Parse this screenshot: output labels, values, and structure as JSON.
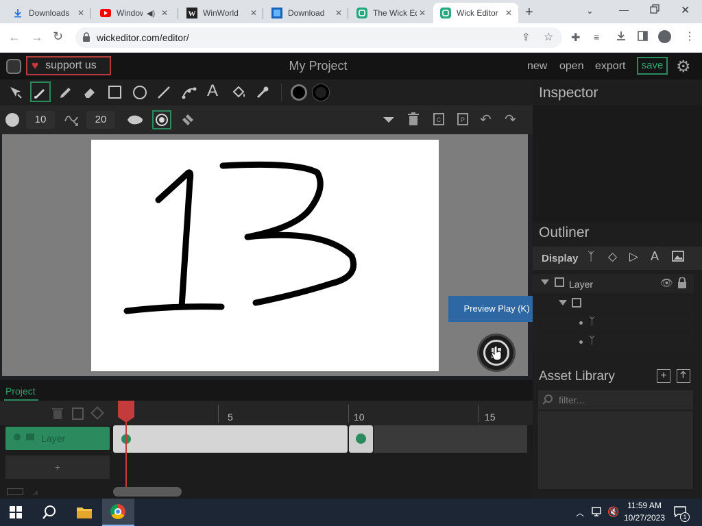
{
  "browser": {
    "tabs": [
      {
        "title": "Downloads",
        "favicon": "download-icon",
        "active": false
      },
      {
        "title": "Windows",
        "favicon": "youtube-icon",
        "active": false,
        "audio": true
      },
      {
        "title": "WinWorld",
        "favicon": "winworld-icon",
        "active": false
      },
      {
        "title": "Download",
        "favicon": "download-site-icon",
        "active": false
      },
      {
        "title": "The Wick Editor",
        "favicon": "wick-icon",
        "active": false
      },
      {
        "title": "Wick Editor",
        "favicon": "wick-icon",
        "active": true
      }
    ],
    "url": "wickeditor.com/editor/"
  },
  "app": {
    "support_label": "support us",
    "project_title": "My Project",
    "menu": {
      "new": "new",
      "open": "open",
      "export": "export",
      "save": "save"
    },
    "brush_size": "10",
    "smoothness": "20",
    "accent": "#2b8a5e",
    "inspector_title": "Inspector",
    "outliner": {
      "title": "Outliner",
      "display_label": "Display",
      "layer_label": "Layer"
    },
    "tooltip": "Preview Play (K)",
    "asset_library": {
      "title": "Asset Library",
      "filter_placeholder": "filter..."
    },
    "timeline": {
      "tab_label": "Project",
      "layer_name": "Layer",
      "add_layer": "+",
      "frame_markers": [
        "5",
        "10",
        "15"
      ]
    }
  },
  "taskbar": {
    "time": "11:59 AM",
    "date": "10/27/2023",
    "notification_count": "1"
  }
}
